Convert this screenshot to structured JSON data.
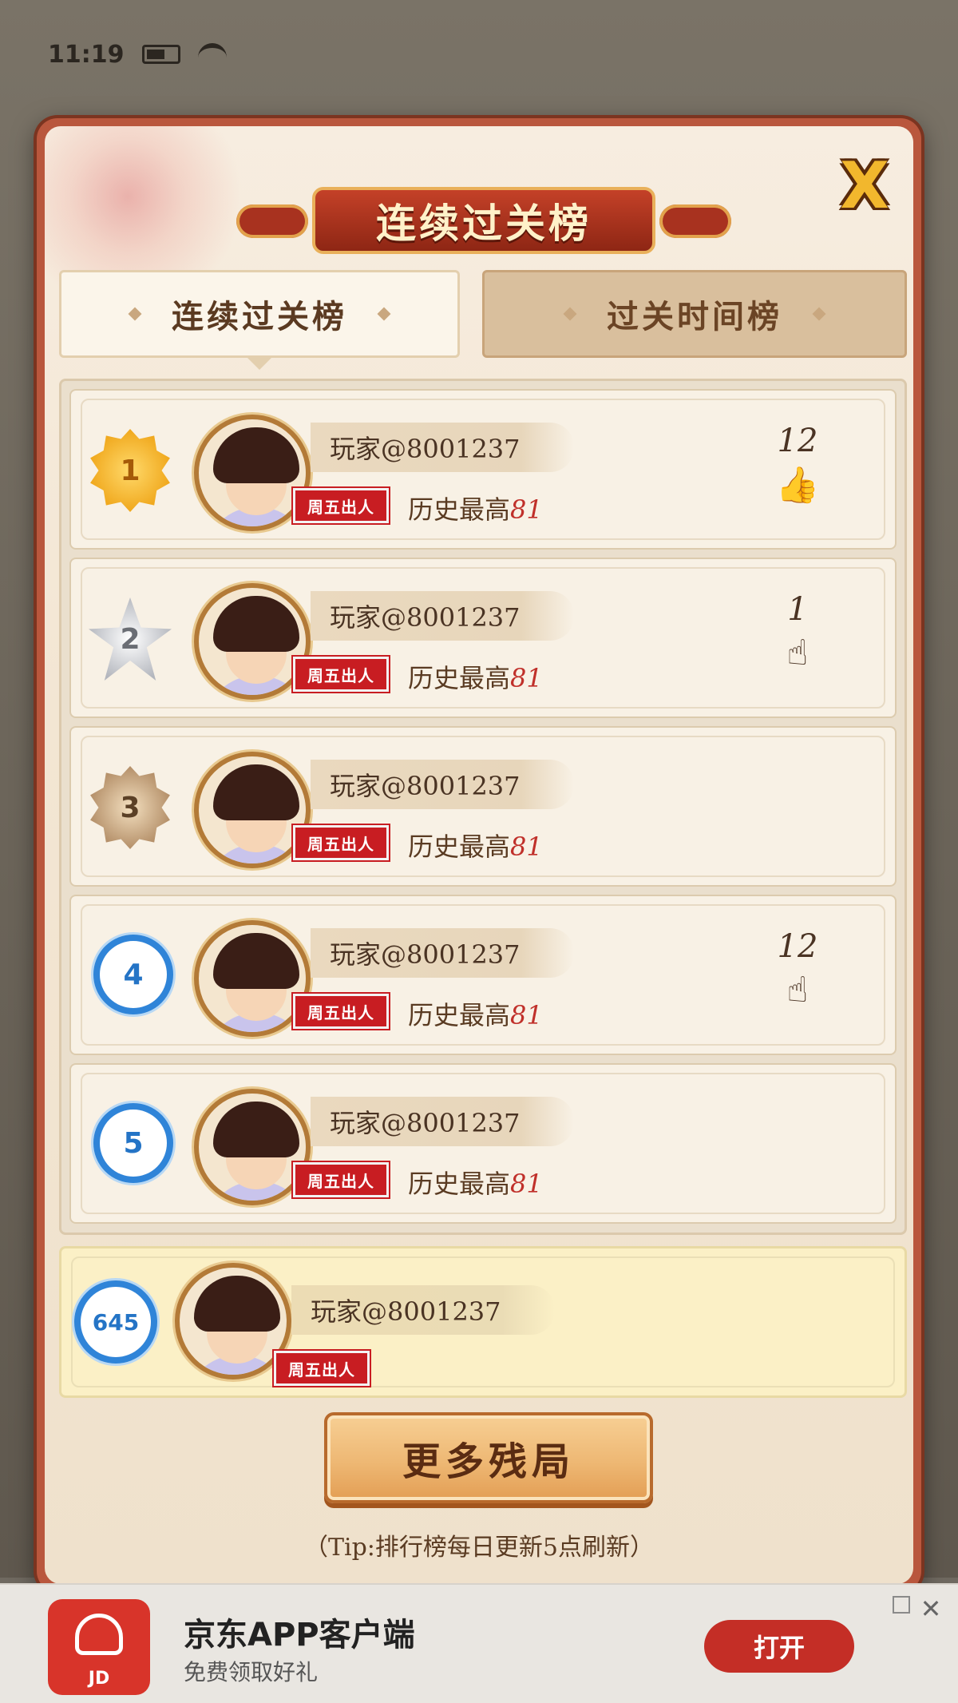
{
  "status_bar": {
    "time": "11:19"
  },
  "background": {
    "title": ""
  },
  "modal": {
    "title": "连续过关榜",
    "close_label": "X",
    "tabs": [
      {
        "label": "连续过关榜",
        "active": true
      },
      {
        "label": "过关时间榜",
        "active": false
      }
    ],
    "rows": [
      {
        "rank": "1",
        "rank_style": "gold",
        "name": "玩家@8001237",
        "badge": "周五出人",
        "history_label": "历史最高",
        "history_value": "81",
        "likes": "12",
        "thumb_filled": true
      },
      {
        "rank": "2",
        "rank_style": "silver",
        "name": "玩家@8001237",
        "badge": "周五出人",
        "history_label": "历史最高",
        "history_value": "81",
        "likes": "1",
        "thumb_filled": false
      },
      {
        "rank": "3",
        "rank_style": "bronze",
        "name": "玩家@8001237",
        "badge": "周五出人",
        "history_label": "历史最高",
        "history_value": "81",
        "likes": "",
        "thumb_filled": false
      },
      {
        "rank": "4",
        "rank_style": "blue",
        "name": "玩家@8001237",
        "badge": "周五出人",
        "history_label": "历史最高",
        "history_value": "81",
        "likes": "12",
        "thumb_filled": false
      },
      {
        "rank": "5",
        "rank_style": "blue",
        "name": "玩家@8001237",
        "badge": "周五出人",
        "history_label": "历史最高",
        "history_value": "81",
        "likes": "",
        "thumb_filled": false
      }
    ],
    "my_row": {
      "rank": "645",
      "name": "玩家@8001237",
      "badge": "周五出人"
    },
    "more_button": "更多残局",
    "tip": "（Tip:排行榜每日更新5点刷新）"
  },
  "ad": {
    "icon_label": "JD",
    "title": "京东APP客户端",
    "subtitle": "免费领取好礼",
    "open_label": "打开",
    "close_label": "✕"
  },
  "colors": {
    "modal_border": "#b9573d",
    "badge_red": "#c81d22",
    "history_value": "#c0302a",
    "rank_blue": "#2f84d8",
    "ad_button": "#c42e26"
  }
}
